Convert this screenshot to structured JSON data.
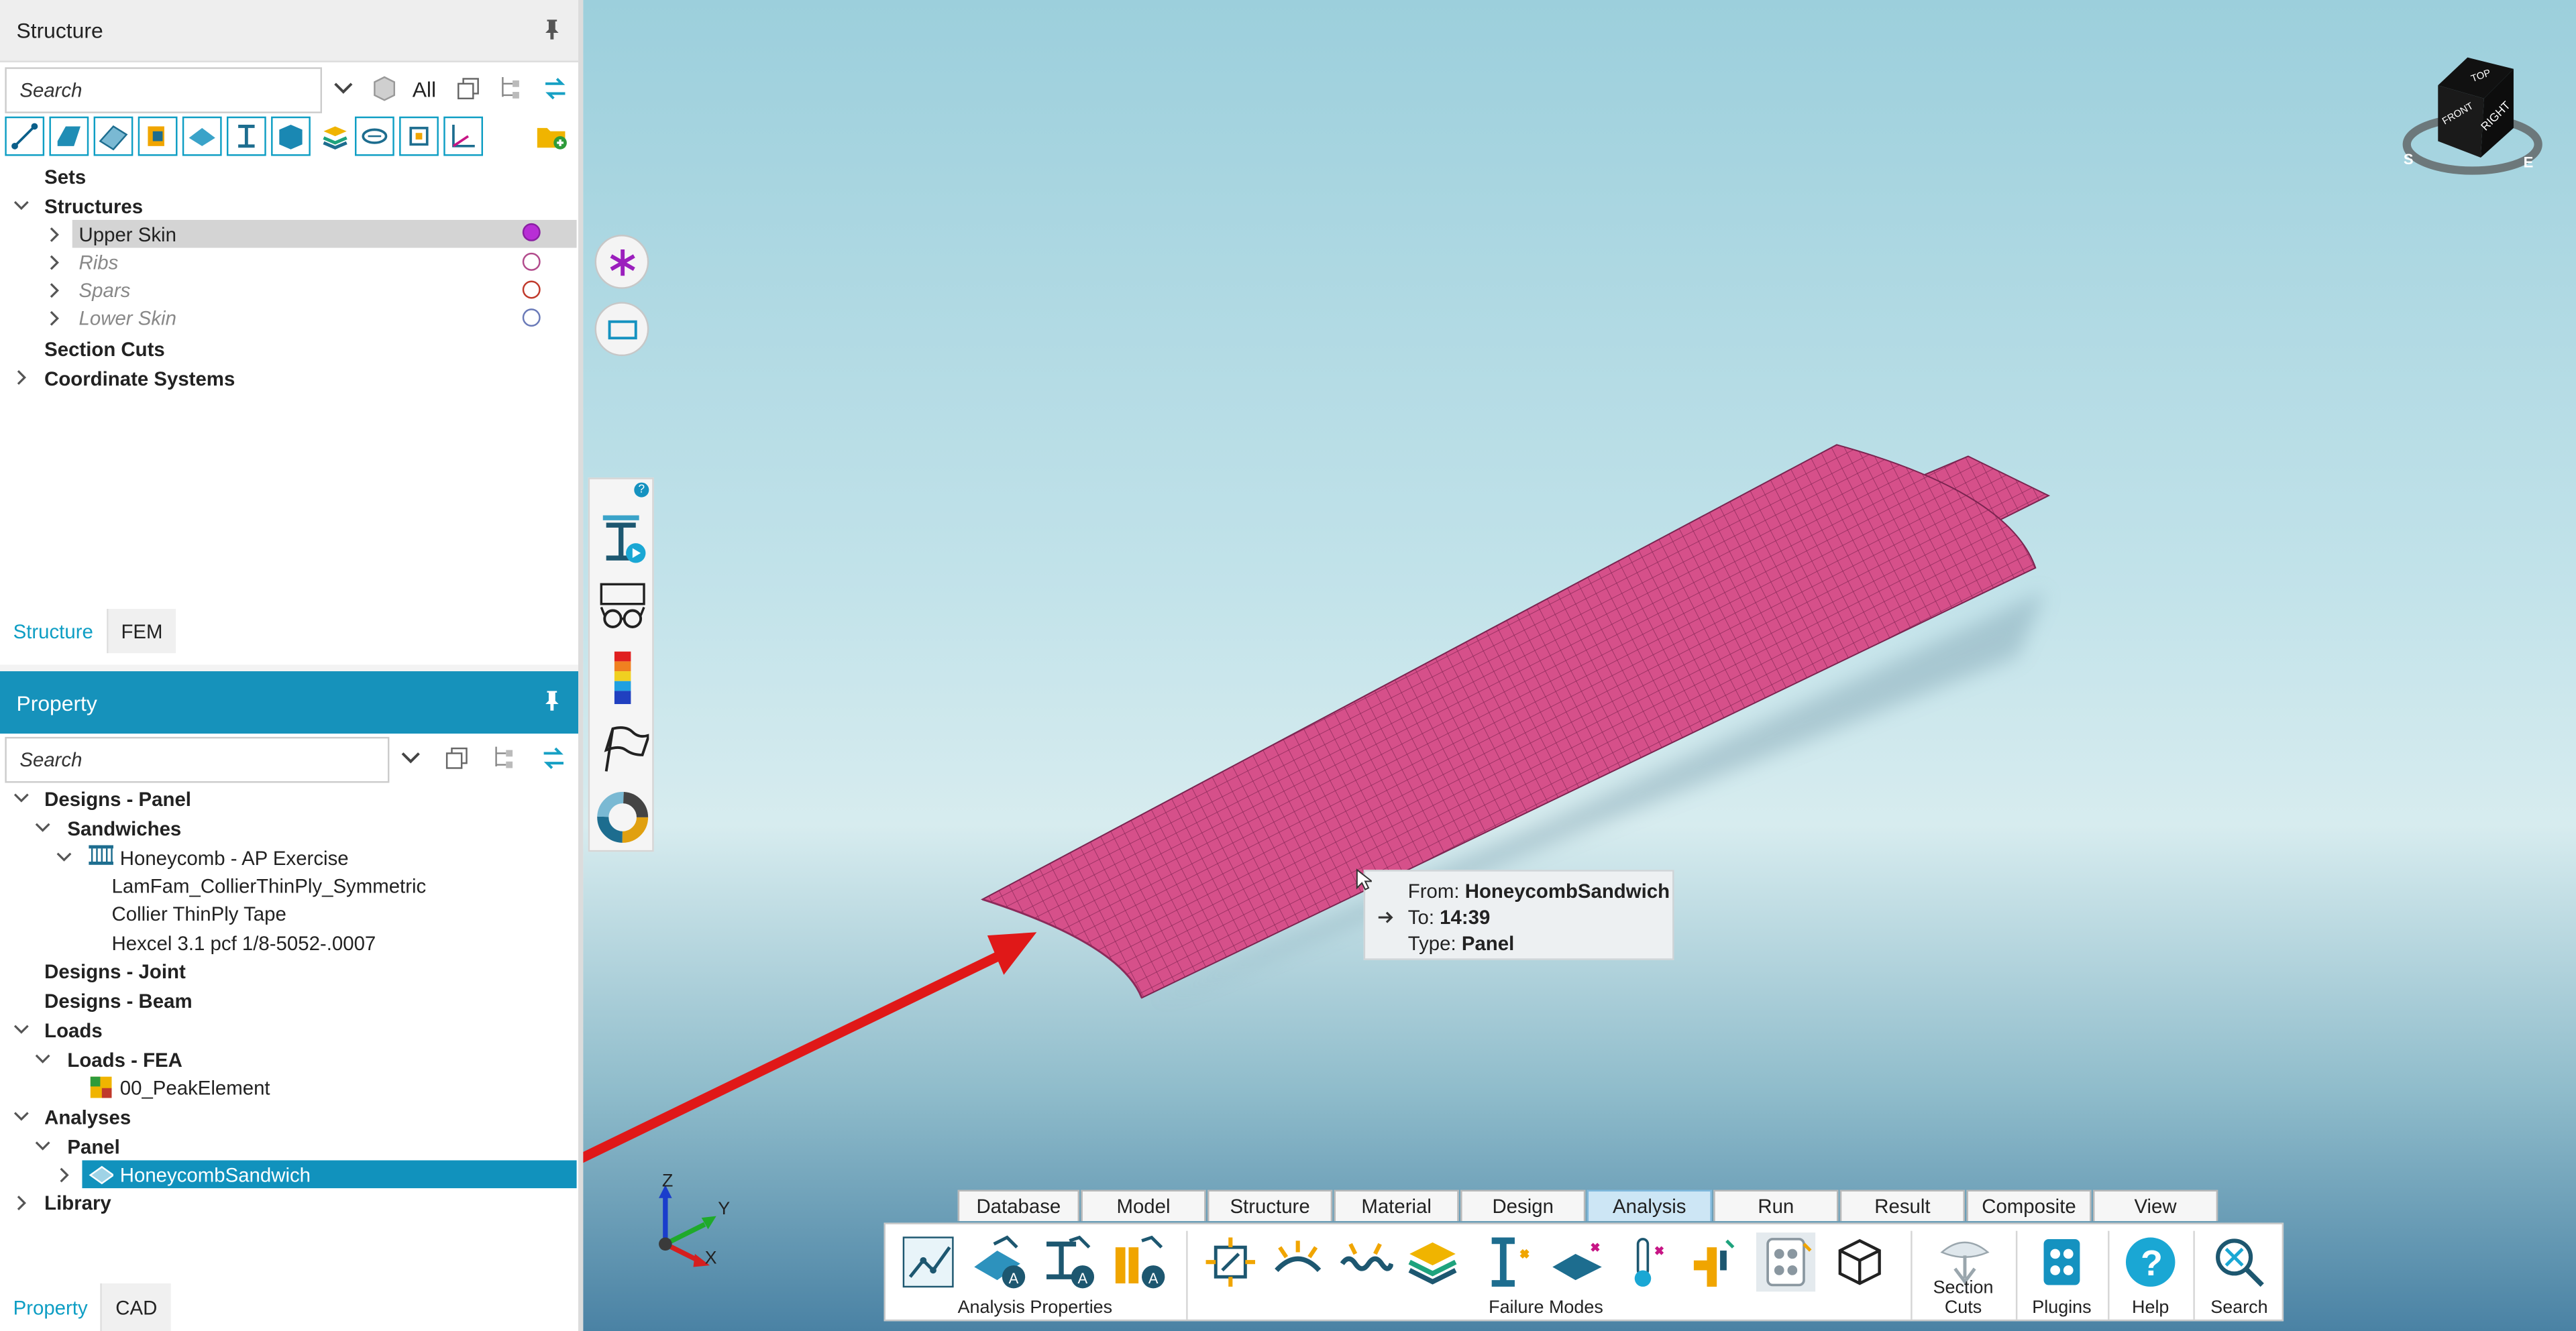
{
  "structure_panel": {
    "title": "Structure",
    "search_placeholder": "Search",
    "all_label": "All",
    "tree": [
      {
        "label": "Sets"
      },
      {
        "label": "Structures"
      },
      {
        "label": "Upper Skin",
        "color": "#b82ed6"
      },
      {
        "label": "Ribs",
        "color": "#b24b8c"
      },
      {
        "label": "Spars",
        "color": "#c0392b"
      },
      {
        "label": "Lower Skin",
        "color": "#6a7ab8"
      },
      {
        "label": "Section Cuts"
      },
      {
        "label": "Coordinate Systems"
      }
    ],
    "tabs": [
      "Structure",
      "FEM"
    ]
  },
  "property_panel": {
    "title": "Property",
    "search_placeholder": "Search",
    "tree": [
      {
        "label": "Designs - Panel"
      },
      {
        "label": "Sandwiches"
      },
      {
        "label": "Honeycomb - AP Exercise"
      },
      {
        "label": "LamFam_CollierThinPly_Symmetric"
      },
      {
        "label": "Collier ThinPly Tape"
      },
      {
        "label": "Hexcel 3.1 pcf 1/8-5052-.0007"
      },
      {
        "label": "Designs - Joint"
      },
      {
        "label": "Designs - Beam"
      },
      {
        "label": "Loads"
      },
      {
        "label": "Loads - FEA"
      },
      {
        "label": "00_PeakElement"
      },
      {
        "label": "Analyses"
      },
      {
        "label": "Panel"
      },
      {
        "label": "HoneycombSandwich"
      },
      {
        "label": "Library"
      }
    ],
    "tabs": [
      "Property",
      "CAD"
    ]
  },
  "viewport": {
    "tooltip": {
      "from_label": "From:",
      "from_value": "HoneycombSandwich",
      "to_label": "To:",
      "to_value": "14:39",
      "type_label": "Type:",
      "type_value": "Panel"
    },
    "axes": {
      "z": "Z",
      "y": "Y",
      "x": "X"
    },
    "view_cube": {
      "top": "TOP",
      "front": "FRONT",
      "right": "RIGHT",
      "s": "S",
      "e": "E"
    },
    "help_badge": "?"
  },
  "ribbon": {
    "tabs": [
      "Database",
      "Model",
      "Structure",
      "Material",
      "Design",
      "Analysis",
      "Run",
      "Result",
      "Composite",
      "View"
    ],
    "active_tab": "Analysis",
    "groups": {
      "analysis_properties": "Analysis Properties",
      "failure_modes": "Failure Modes",
      "section_cuts": "Section Cuts",
      "plugins": "Plugins",
      "help": "Help",
      "search": "Search"
    }
  },
  "colors": {
    "accent": "#0e9ec4",
    "selection": "#1192bd",
    "panel_mesh": "#d6508a",
    "arrow": "#e01818"
  }
}
